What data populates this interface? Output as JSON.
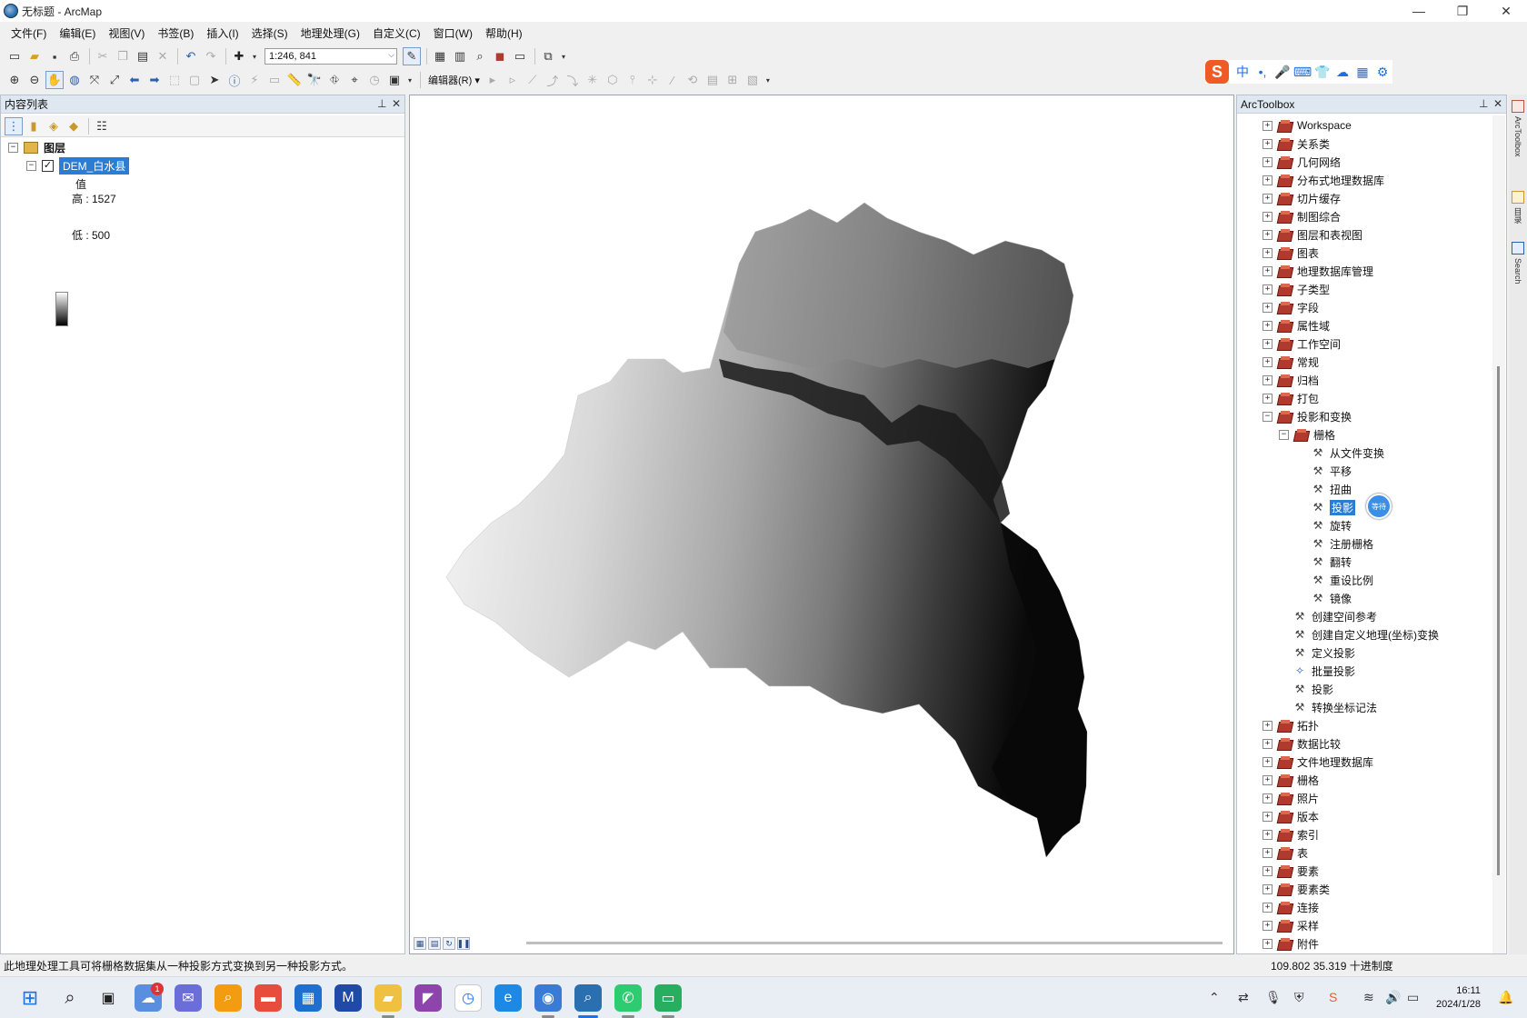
{
  "window": {
    "title": "无标题 - ArcMap",
    "minimize": "—",
    "restore": "❐",
    "close": "✕"
  },
  "menu": [
    "文件(F)",
    "编辑(E)",
    "视图(V)",
    "书签(B)",
    "插入(I)",
    "选择(S)",
    "地理处理(G)",
    "自定义(C)",
    "窗口(W)",
    "帮助(H)"
  ],
  "toolbar": {
    "scale": "1:246, 841",
    "editor_label": "编辑器(R) ▾"
  },
  "toc": {
    "title": "内容列表",
    "root_label": "图层",
    "layer_name": "DEM_白水县",
    "legend_heading": "值",
    "legend_high": "高 : 1527",
    "legend_low": "低 : 500"
  },
  "toolbox": {
    "title": "ArcToolbox",
    "items_top": [
      "Workspace",
      "关系类",
      "几何网络",
      "分布式地理数据库",
      "切片缓存",
      "制图综合",
      "图层和表视图",
      "图表",
      "地理数据库管理",
      "子类型",
      "字段",
      "属性域",
      "工作空间",
      "常规",
      "归档",
      "打包",
      "投影和变换"
    ],
    "raster_group": "栅格",
    "raster_tools": [
      "从文件变换",
      "平移",
      "扭曲",
      "投影栅格",
      "旋转",
      "注册栅格",
      "翻转",
      "重设比例",
      "镜像"
    ],
    "proj_tools": [
      "创建空间参考",
      "创建自定义地理(坐标)变换",
      "定义投影",
      "批量投影",
      "投影",
      "转换坐标记法"
    ],
    "items_bottom": [
      "拓扑",
      "数据比较",
      "文件地理数据库",
      "栅格",
      "照片",
      "版本",
      "索引",
      "表",
      "要素",
      "要素类",
      "连接",
      "采样",
      "附件"
    ],
    "selected_display": "投影",
    "cursor_text": "等待"
  },
  "sidedock": {
    "tab1": "ArcToolbox",
    "tab2": "目录",
    "tab3": "Search"
  },
  "status": {
    "message": "此地理处理工具可将栅格数据集从一种投影方式变换到另一种投影方式。",
    "coords": "109.802  35.319 十进制度"
  },
  "taskbar": {
    "time": "16:11",
    "date": "2024/1/28",
    "notification_count": "1"
  },
  "colors": {
    "selection": "#2b7cd3",
    "dem_high": "#ffffff",
    "dem_low": "#000000",
    "toolbox_icon": "#b03a2e"
  }
}
